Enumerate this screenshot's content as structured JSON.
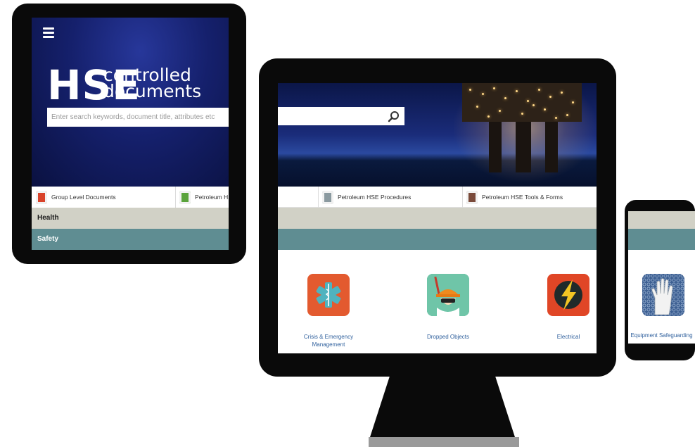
{
  "tablet": {
    "menu_icon": "hamburger-icon",
    "brand_hse": "HSE",
    "brand_line1": "controlled",
    "brand_line2": "documents",
    "search_placeholder": "Enter search keywords, document title, attributes etc",
    "categories": [
      {
        "label": "Group Level Documents",
        "icon": "document-red-icon",
        "color": "#d9432a"
      },
      {
        "label": "Petroleum HSE",
        "icon": "document-green-icon",
        "color": "#5aa33b"
      }
    ],
    "rows": [
      {
        "label": "Health",
        "color": "#d1d1c6"
      },
      {
        "label": "Safety",
        "color": "#5f8d92"
      }
    ]
  },
  "desktop": {
    "search_icon": "search-icon",
    "hero_image": "offshore-oil-platform-at-night",
    "categories": [
      {
        "label": "Petroleum HSE Procedures",
        "icon": "procedures-document-icon"
      },
      {
        "label": "Petroleum HSE Tools & Forms",
        "icon": "tools-forms-document-icon"
      }
    ],
    "tiles": [
      {
        "label": "Crisis & Emergency Management",
        "icon": "star-of-life-icon",
        "color": "#e35a2f"
      },
      {
        "label": "Dropped Objects",
        "icon": "hard-hat-worker-icon",
        "color": "#5fb89c"
      },
      {
        "label": "Electrical",
        "icon": "lightning-bolt-icon",
        "color": "#e04626"
      }
    ]
  },
  "phone": {
    "tile": {
      "label": "Equipment Safeguarding",
      "icon": "safety-glove-icon",
      "color": "#2f4f7d"
    }
  }
}
